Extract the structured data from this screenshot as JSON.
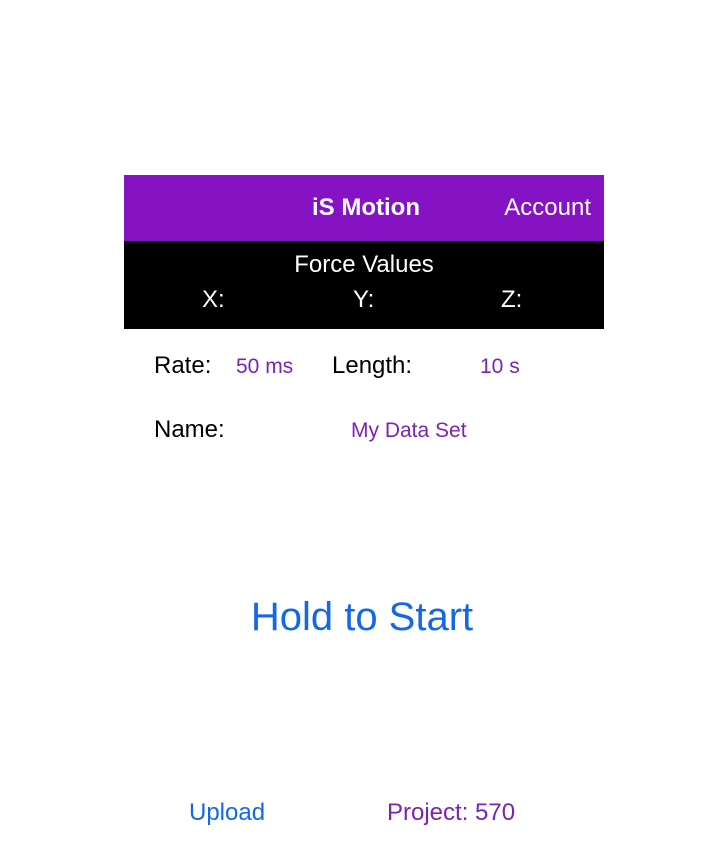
{
  "navbar": {
    "title": "iS Motion",
    "account_label": "Account",
    "background_color": "#8513c4"
  },
  "force_panel": {
    "title": "Force Values",
    "x_label": "X:",
    "y_label": "Y:",
    "z_label": "Z:"
  },
  "settings": {
    "rate_label": "Rate:",
    "rate_value": "50 ms",
    "length_label": "Length:",
    "length_value": "10 s",
    "name_label": "Name:",
    "name_value": "My Data Set",
    "value_color": "#7b22b8"
  },
  "actions": {
    "start_label": "Hold to Start",
    "upload_label": "Upload",
    "project_label": "Project: 570",
    "accent_color": "#1368e8"
  }
}
